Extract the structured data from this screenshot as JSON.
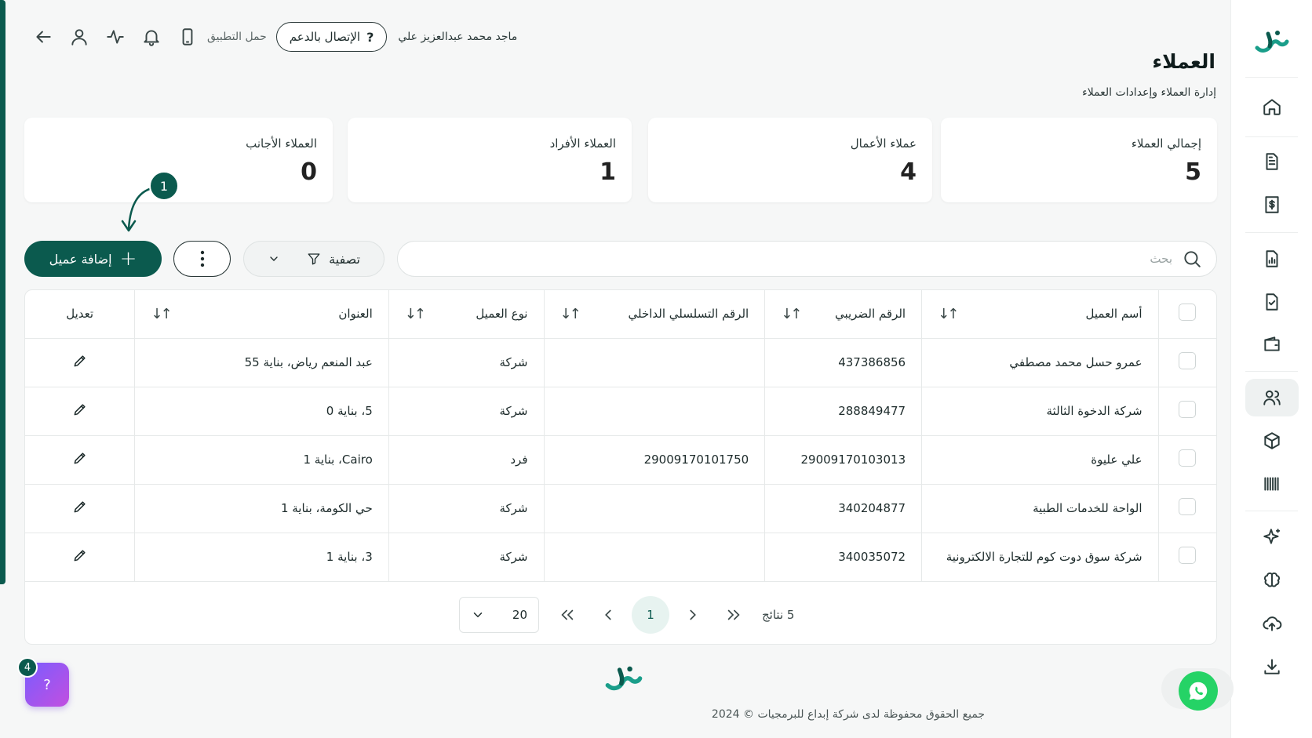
{
  "header": {
    "user_name": "ماجد محمد عبدالعزيز علي",
    "support_label": "الإتصال بالدعم",
    "support_icon": "?",
    "download_app": "حمل التطبيق"
  },
  "page": {
    "title": "العملاء",
    "subtitle": "إدارة العملاء وإعدادات العملاء"
  },
  "stats": [
    {
      "label": "إجمالي العملاء",
      "value": "5"
    },
    {
      "label": "عملاء الأعمال",
      "value": "4"
    },
    {
      "label": "العملاء الأفراد",
      "value": "1"
    },
    {
      "label": "العملاء الأجانب",
      "value": "0"
    }
  ],
  "annotation": {
    "step": "1"
  },
  "toolbar": {
    "add_label": "إضافة عميل",
    "filter_label": "تصفية",
    "search_placeholder": "بحث"
  },
  "table": {
    "columns": {
      "name": "أسم العميل",
      "tax": "الرقم الضريبي",
      "serial": "الرقم التسلسلي الداخلي",
      "type": "نوع العميل",
      "address": "العنوان",
      "edit": "تعديل"
    },
    "rows": [
      {
        "name": "عمرو حسل محمد مصطفي",
        "tax": "437386856",
        "serial": "",
        "type": "شركة",
        "address": "عبد المنعم رياض، بناية 55"
      },
      {
        "name": "شركة الدخوة الثالثة",
        "tax": "288849477",
        "serial": "",
        "type": "شركة",
        "address": "5، بناية 0"
      },
      {
        "name": "علي عليوة",
        "tax": "29009170103013",
        "serial": "29009170101750",
        "type": "فرد",
        "address": "Cairo، بناية 1"
      },
      {
        "name": "الواحة للخدمات الطبية",
        "tax": "340204877",
        "serial": "",
        "type": "شركة",
        "address": "حي الكومة، بناية 1"
      },
      {
        "name": "شركة سوق دوت كوم للتجارة الالكترونية",
        "tax": "340035072",
        "serial": "",
        "type": "شركة",
        "address": "3، بناية 1"
      }
    ]
  },
  "pagination": {
    "page_size": "20",
    "current_page": "1",
    "results": "5 نتائج"
  },
  "footer": {
    "copyright": "جميع الحقوق محفوظة لدى شركة إبداع للبرمجيات © 2024"
  },
  "help": {
    "count": "4",
    "icon": "?"
  },
  "sidebar": {
    "icons": [
      "home-icon",
      "document-icon",
      "invoice-icon",
      "report-icon",
      "file-check-icon",
      "wallet-icon",
      "users-icon",
      "package-icon",
      "barcode-icon",
      "sparkle-icon",
      "brain-icon",
      "cloud-upload-icon",
      "download-icon"
    ],
    "active": "users-icon"
  },
  "colors": {
    "brand": "#0b5a4e",
    "accent_light": "#e7f3f0",
    "whatsapp": "#25d366"
  }
}
